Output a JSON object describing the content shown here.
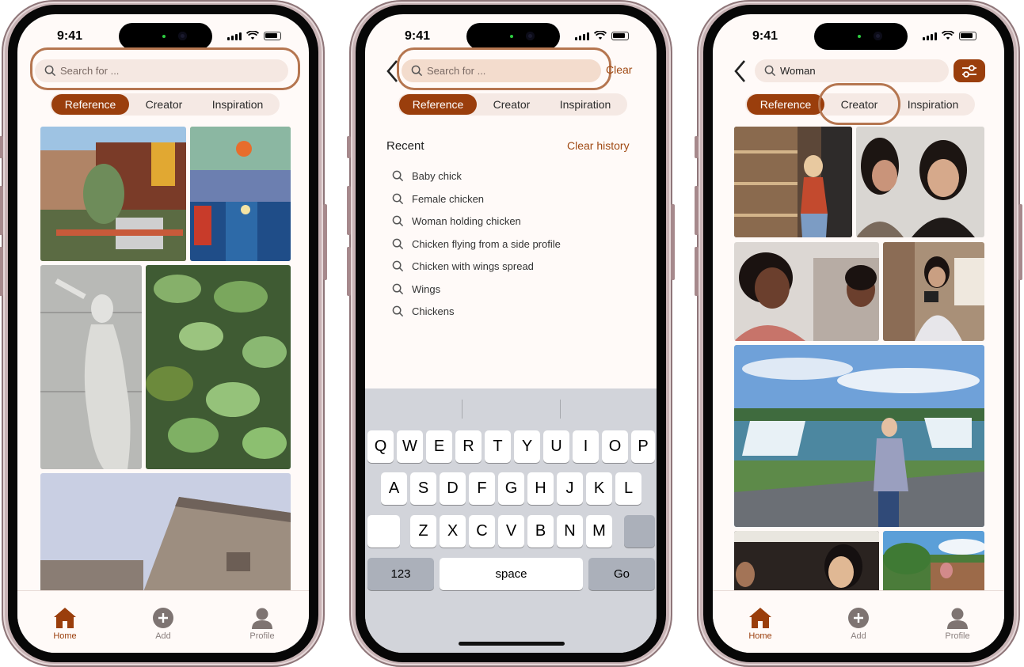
{
  "status": {
    "time": "9:41"
  },
  "search": {
    "placeholder": "Search for ...",
    "clear_label": "Clear",
    "query_value": "Woman"
  },
  "tabs": [
    {
      "label": "Reference",
      "active": true
    },
    {
      "label": "Creator",
      "active": false
    },
    {
      "label": "Inspiration",
      "active": false
    }
  ],
  "recent": {
    "title": "Recent",
    "clear_history_label": "Clear history",
    "items": [
      "Baby chick",
      "Female chicken",
      "Woman holding chicken",
      "Chicken flying from a side profile",
      "Chicken with wings spread",
      "Wings",
      "Chickens"
    ]
  },
  "nav": {
    "home_label": "Home",
    "add_label": "Add",
    "profile_label": "Profile"
  },
  "keyboard": {
    "row1": [
      "Q",
      "W",
      "E",
      "R",
      "T",
      "Y",
      "U",
      "I",
      "O",
      "P"
    ],
    "row2": [
      "A",
      "S",
      "D",
      "F",
      "G",
      "H",
      "J",
      "K",
      "L"
    ],
    "row3": [
      "Z",
      "X",
      "C",
      "V",
      "B",
      "N",
      "M"
    ],
    "numbers_label": "123",
    "space_label": "space",
    "go_label": "Go"
  },
  "colors": {
    "accent": "#9a3e0c",
    "halo": "#b57650",
    "pill_bg": "#f5e9e4",
    "search_bg": "#f5e8e2"
  },
  "icons": [
    "search-icon",
    "back-chevron-icon",
    "filter-sliders-icon",
    "home-icon",
    "add-icon",
    "profile-icon",
    "wifi-icon",
    "signal-icon",
    "battery-icon"
  ]
}
